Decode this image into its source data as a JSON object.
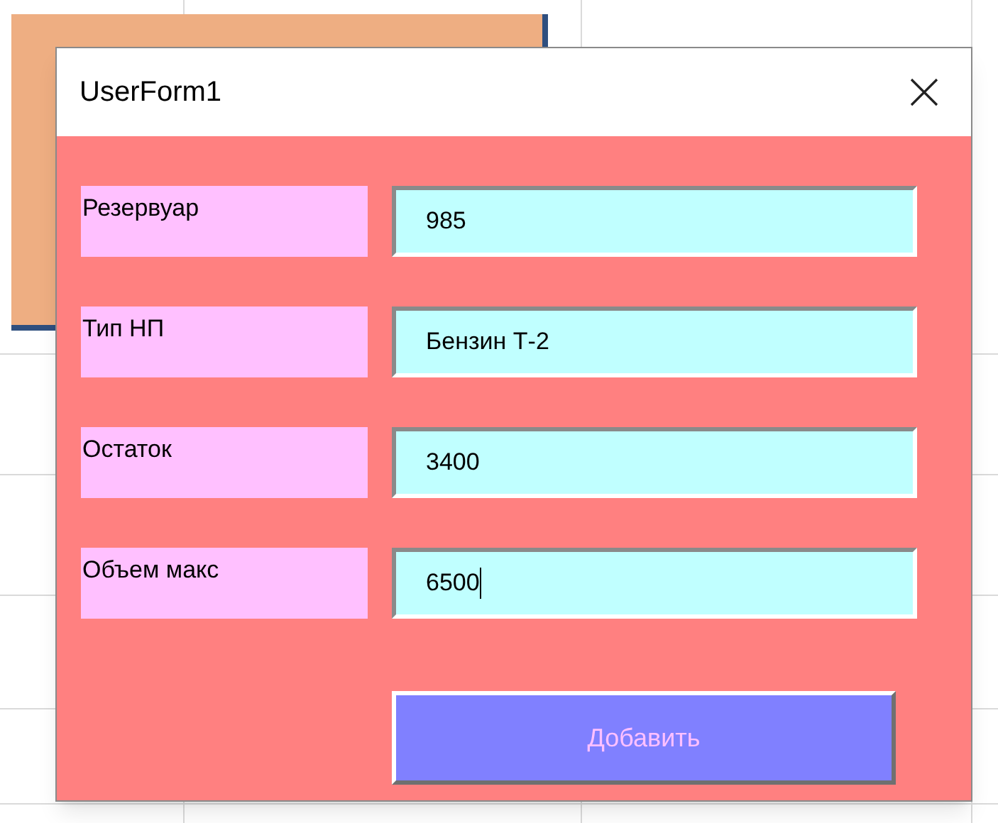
{
  "window": {
    "title": "UserForm1"
  },
  "fields": [
    {
      "label": "Резервуар",
      "value": "985",
      "focused": false
    },
    {
      "label": "Тип НП",
      "value": "Бензин Т-2",
      "focused": false
    },
    {
      "label": "Остаток",
      "value": "3400",
      "focused": false
    },
    {
      "label": "Объем макс",
      "value": "6500",
      "focused": true
    }
  ],
  "buttons": [
    "Добавить"
  ]
}
